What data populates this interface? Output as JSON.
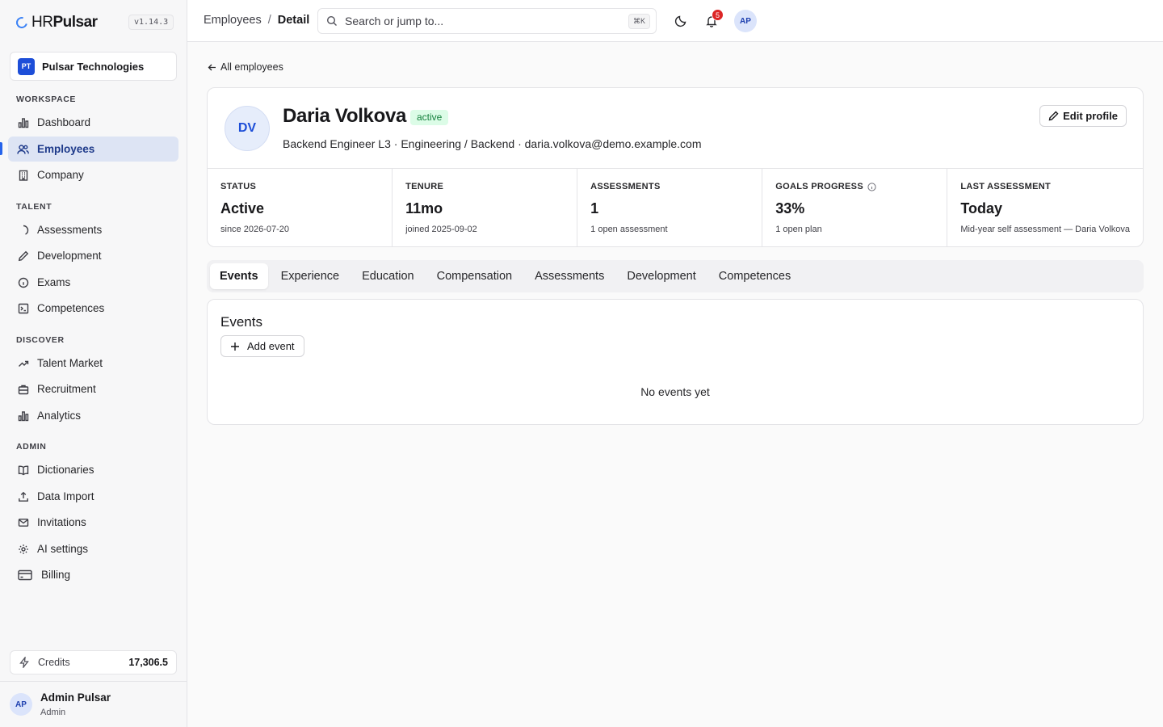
{
  "sidebar": {
    "brand": {
      "hr": "HR",
      "pulsar": "Pulsar"
    },
    "version": "v1.14.3",
    "org": {
      "initials": "PT",
      "name": "Pulsar Technologies"
    },
    "sections": {
      "workspace": "WORKSPACE",
      "talent": "TALENT",
      "discover": "DISCOVER",
      "admin": "ADMIN"
    },
    "items": {
      "dashboard": "Dashboard",
      "employees": "Employees",
      "company": "Company",
      "assessments": "Assessments",
      "development": "Development",
      "exams": "Exams",
      "competences": "Competences",
      "talent_market": "Talent Market",
      "recruitment": "Recruitment",
      "analytics": "Analytics",
      "dictionaries": "Dictionaries",
      "data_import": "Data Import",
      "invitations": "Invitations",
      "ai_settings": "AI settings",
      "billing": "Billing"
    },
    "credits": {
      "label": "Credits",
      "value": "17,306.5"
    },
    "user": {
      "initials": "AP",
      "name": "Admin Pulsar",
      "role": "Admin"
    }
  },
  "topbar": {
    "breadcrumb": {
      "parent": "Employees",
      "separator": "/",
      "current": "Detail"
    },
    "search": {
      "placeholder": "Search or jump to...",
      "shortcut": "⌘K"
    },
    "notifications_count": "5",
    "avatar_initials": "AP"
  },
  "main": {
    "back_label": "All employees",
    "profile": {
      "initials": "DV",
      "name": "Daria Volkova",
      "status": "active",
      "meta": "Backend Engineer L3 · Engineering / Backend · daria.volkova@demo.example.com",
      "edit_label": "Edit profile"
    },
    "stats": [
      {
        "label": "STATUS",
        "value": "Active",
        "sub": "since 2026-07-20"
      },
      {
        "label": "TENURE",
        "value": "11mo",
        "sub": "joined 2025-09-02"
      },
      {
        "label": "ASSESSMENTS",
        "value": "1",
        "sub": "1 open assessment"
      },
      {
        "label": "GOALS PROGRESS",
        "value": "33%",
        "sub": "1 open plan"
      },
      {
        "label": "LAST ASSESSMENT",
        "value": "Today",
        "sub": "Mid-year self assessment — Daria Volkova"
      }
    ],
    "tabs": [
      "Events",
      "Experience",
      "Education",
      "Compensation",
      "Assessments",
      "Development",
      "Competences"
    ],
    "events": {
      "title": "Events",
      "add_label": "Add event",
      "empty_text": "No events yet"
    }
  },
  "colors": {
    "accent": "#2563eb",
    "active_nav_bg": "#dde4f4",
    "status_badge_bg": "#dcfce7",
    "status_badge_text": "#15803d",
    "notification_badge": "#dc2626"
  }
}
